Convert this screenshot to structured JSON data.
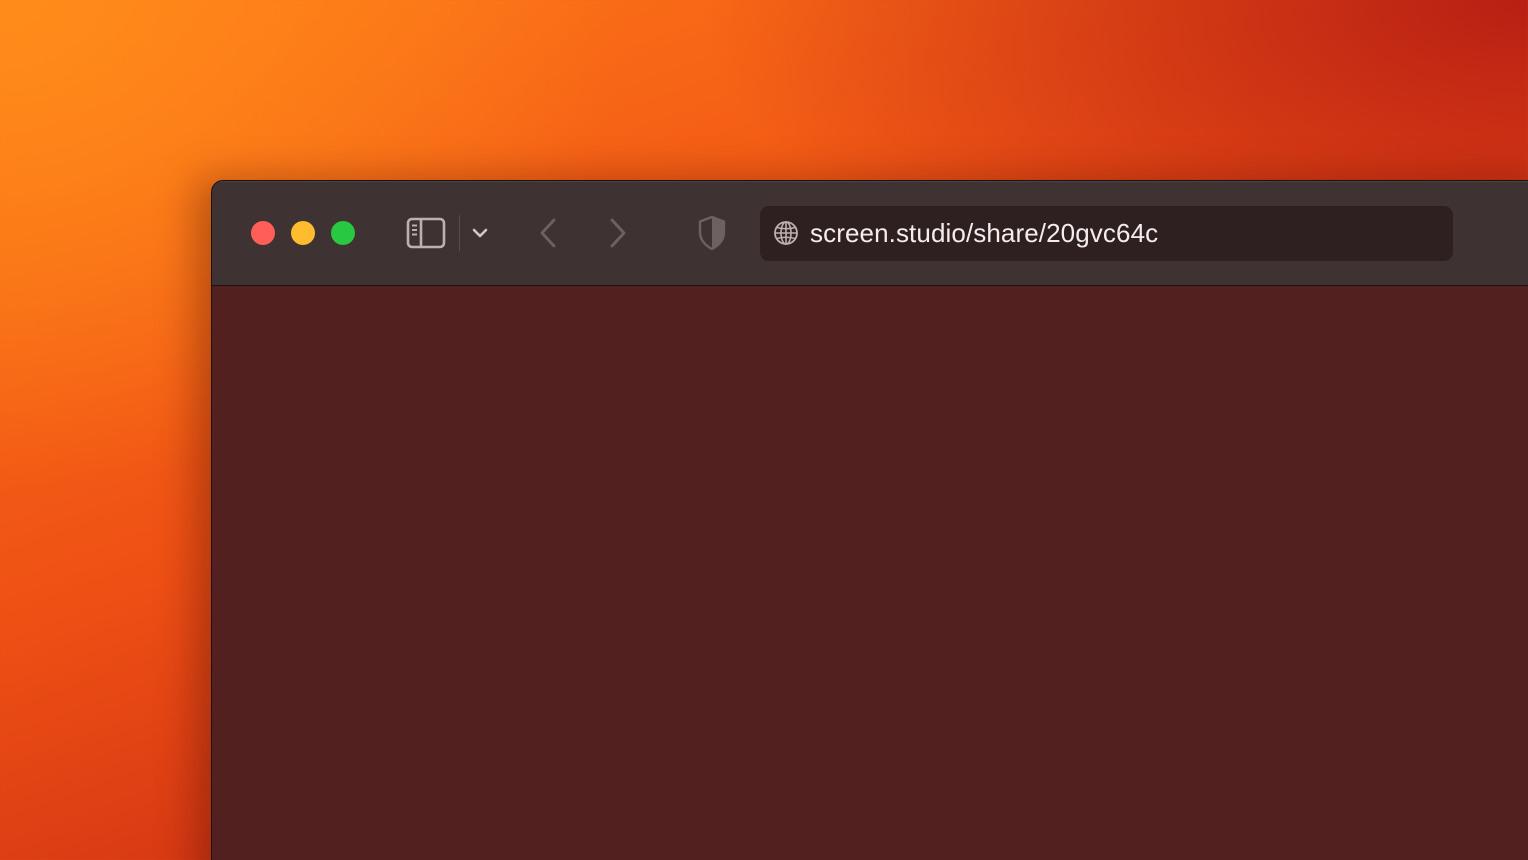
{
  "browser": {
    "address_bar": {
      "url": "screen.studio/share/20gvc64c",
      "icon": "globe-icon"
    },
    "toolbar": {
      "icons": {
        "sidebar": "sidebar-icon",
        "tab_group_menu": "chevron-down-icon",
        "back": "chevron-left-icon",
        "forward": "chevron-right-icon",
        "privacy": "shield-icon"
      }
    },
    "window_controls": {
      "close_color": "#ff5f57",
      "minimize_color": "#febc2e",
      "zoom_color": "#28c840"
    }
  },
  "colors": {
    "toolbar_bg": "#3f3233",
    "address_bg": "#2e2021",
    "content_bg": "#532020",
    "desktop_orange": "#ff7a18",
    "desktop_red": "#b51d12"
  }
}
